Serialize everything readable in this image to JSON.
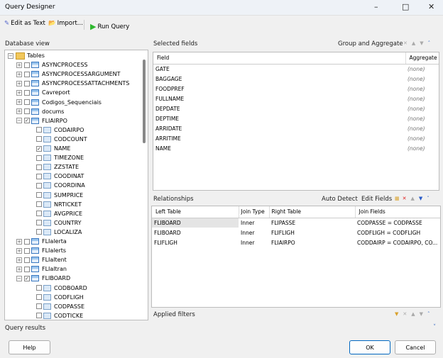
{
  "window": {
    "title": "Query Designer"
  },
  "toolbar": {
    "edit_as_text": "Edit as Text",
    "import": "Import...",
    "run_query": "Run Query"
  },
  "database_view": {
    "title": "Database view",
    "tree": [
      {
        "label": "Tables",
        "level": 0,
        "kind": "folder",
        "expanded": true
      },
      {
        "label": "ASYNCPROCESS",
        "level": 1,
        "kind": "table",
        "checked": false
      },
      {
        "label": "ASYNCPROCESSARGUMENT",
        "level": 1,
        "kind": "table",
        "checked": false
      },
      {
        "label": "ASYNCPROCESSATTACHMENTS",
        "level": 1,
        "kind": "table",
        "checked": false
      },
      {
        "label": "Cavreport",
        "level": 1,
        "kind": "table",
        "checked": false
      },
      {
        "label": "Codigos_Sequenciais",
        "level": 1,
        "kind": "table",
        "checked": false
      },
      {
        "label": "docums",
        "level": 1,
        "kind": "table",
        "checked": false
      },
      {
        "label": "FLIAIRPO",
        "level": 1,
        "kind": "table",
        "checked": true,
        "expanded": true
      },
      {
        "label": "CODAIRPO",
        "level": 2,
        "kind": "field",
        "checked": false
      },
      {
        "label": "CODCOUNT",
        "level": 2,
        "kind": "field",
        "checked": false
      },
      {
        "label": "NAME",
        "level": 2,
        "kind": "field",
        "checked": true
      },
      {
        "label": "TIMEZONE",
        "level": 2,
        "kind": "field",
        "checked": false
      },
      {
        "label": "ZZSTATE",
        "level": 2,
        "kind": "field",
        "checked": false
      },
      {
        "label": "COODINAT",
        "level": 2,
        "kind": "field",
        "checked": false
      },
      {
        "label": "COORDINA",
        "level": 2,
        "kind": "field",
        "checked": false
      },
      {
        "label": "SUMPRICE",
        "level": 2,
        "kind": "field",
        "checked": false
      },
      {
        "label": "NRTICKET",
        "level": 2,
        "kind": "field",
        "checked": false
      },
      {
        "label": "AVGPRICE",
        "level": 2,
        "kind": "field",
        "checked": false
      },
      {
        "label": "COUNTRY",
        "level": 2,
        "kind": "field",
        "checked": false
      },
      {
        "label": "LOCALIZA",
        "level": 2,
        "kind": "field",
        "checked": false
      },
      {
        "label": "FLIalerta",
        "level": 1,
        "kind": "table",
        "checked": false
      },
      {
        "label": "FLIalerts",
        "level": 1,
        "kind": "table",
        "checked": false
      },
      {
        "label": "FLIaltent",
        "level": 1,
        "kind": "table",
        "checked": false
      },
      {
        "label": "FLIaltran",
        "level": 1,
        "kind": "table",
        "checked": false
      },
      {
        "label": "FLIBOARD",
        "level": 1,
        "kind": "table",
        "checked": true,
        "expanded": true
      },
      {
        "label": "CODBOARD",
        "level": 2,
        "kind": "field",
        "checked": false
      },
      {
        "label": "CODFLIGH",
        "level": 2,
        "kind": "field",
        "checked": false
      },
      {
        "label": "CODPASSE",
        "level": 2,
        "kind": "field",
        "checked": false
      },
      {
        "label": "CODTICKE",
        "level": 2,
        "kind": "field",
        "checked": false
      }
    ]
  },
  "selected_fields": {
    "title": "Selected fields",
    "group_aggregate": "Group and Aggregate",
    "columns": [
      "Field",
      "Aggregate"
    ],
    "rows": [
      [
        "GATE",
        "(none)"
      ],
      [
        "BAGGAGE",
        "(none)"
      ],
      [
        "FOODPREF",
        "(none)"
      ],
      [
        "FULLNAME",
        "(none)"
      ],
      [
        "DEPDATE",
        "(none)"
      ],
      [
        "DEPTIME",
        "(none)"
      ],
      [
        "ARRIDATE",
        "(none)"
      ],
      [
        "ARRITIME",
        "(none)"
      ],
      [
        "NAME",
        "(none)"
      ]
    ]
  },
  "relationships": {
    "title": "Relationships",
    "auto_detect": "Auto Detect",
    "edit_fields": "Edit Fields",
    "columns": [
      "Left Table",
      "Join Type",
      "Right Table",
      "Join Fields"
    ],
    "rows": [
      [
        "FLIBOARD",
        "Inner",
        "FLIPASSE",
        "CODPASSE = CODPASSE"
      ],
      [
        "FLIBOARD",
        "Inner",
        "FLIFLIGH",
        "CODFLIGH = CODFLIGH"
      ],
      [
        "FLIFLIGH",
        "Inner",
        "FLIAIRPO",
        "CODDAIRP = CODAIRPO, CO..."
      ]
    ]
  },
  "applied_filters": {
    "title": "Applied filters"
  },
  "query_results": {
    "title": "Query results"
  },
  "buttons": {
    "help": "Help",
    "ok": "OK",
    "cancel": "Cancel"
  }
}
